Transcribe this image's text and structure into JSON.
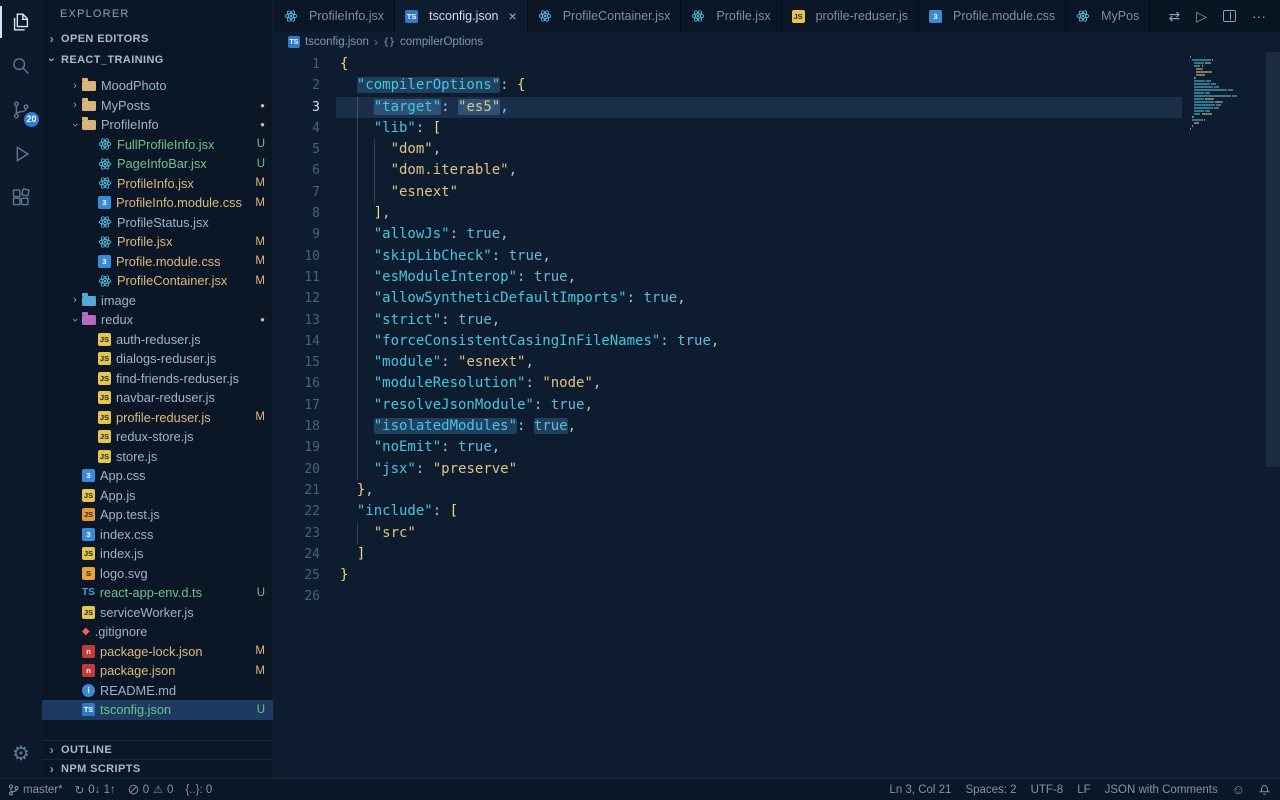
{
  "activity_bar": {
    "badge": "20"
  },
  "sidebar": {
    "title": "EXPLORER",
    "sections": {
      "open_editors": "OPEN EDITORS",
      "project": "REACT_TRAINING",
      "outline": "OUTLINE",
      "npm_scripts": "NPM SCRIPTS"
    },
    "tree": [
      {
        "label": "MoodPhoto",
        "icon": "folder",
        "depth": 1,
        "folder": true,
        "expanded": false
      },
      {
        "label": "MyPosts",
        "icon": "folder",
        "depth": 1,
        "folder": true,
        "expanded": false,
        "dot": true
      },
      {
        "label": "ProfileInfo",
        "icon": "folder",
        "depth": 1,
        "folder": true,
        "expanded": true,
        "dot": true
      },
      {
        "label": "FullProfileInfo.jsx",
        "icon": "react",
        "depth": 2,
        "badge": "U",
        "git": "unt"
      },
      {
        "label": "PageInfoBar.jsx",
        "icon": "react",
        "depth": 2,
        "badge": "U",
        "git": "unt"
      },
      {
        "label": "ProfileInfo.jsx",
        "icon": "react",
        "depth": 2,
        "badge": "M",
        "git": "mod"
      },
      {
        "label": "ProfileInfo.module.css",
        "icon": "css",
        "depth": 2,
        "badge": "M",
        "git": "mod"
      },
      {
        "label": "ProfileStatus.jsx",
        "icon": "react",
        "depth": 2
      },
      {
        "label": "Profile.jsx",
        "icon": "react",
        "depth": 2,
        "badge": "M",
        "git": "mod"
      },
      {
        "label": "Profile.module.css",
        "icon": "css",
        "depth": 2,
        "badge": "M",
        "git": "mod"
      },
      {
        "label": "ProfileContainer.jsx",
        "icon": "react",
        "depth": 2,
        "badge": "M",
        "git": "mod"
      },
      {
        "label": "image",
        "icon": "folder-image",
        "depth": 1,
        "folder": true,
        "expanded": false
      },
      {
        "label": "redux",
        "icon": "folder-redux",
        "depth": 1,
        "folder": true,
        "expanded": true,
        "dot": true
      },
      {
        "label": "auth-reduser.js",
        "icon": "js",
        "depth": 2
      },
      {
        "label": "dialogs-reduser.js",
        "icon": "js",
        "depth": 2
      },
      {
        "label": "find-friends-reduser.js",
        "icon": "js",
        "depth": 2
      },
      {
        "label": "navbar-reduser.js",
        "icon": "js",
        "depth": 2
      },
      {
        "label": "profile-reduser.js",
        "icon": "js",
        "depth": 2,
        "badge": "M",
        "git": "mod"
      },
      {
        "label": "redux-store.js",
        "icon": "js",
        "depth": 2
      },
      {
        "label": "store.js",
        "icon": "js",
        "depth": 2
      },
      {
        "label": "App.css",
        "icon": "css",
        "depth": 1
      },
      {
        "label": "App.js",
        "icon": "js",
        "depth": 1
      },
      {
        "label": "App.test.js",
        "icon": "jstest",
        "depth": 1
      },
      {
        "label": "index.css",
        "icon": "css",
        "depth": 1
      },
      {
        "label": "index.js",
        "icon": "js",
        "depth": 1
      },
      {
        "label": "logo.svg",
        "icon": "svg",
        "depth": 1
      },
      {
        "label": "react-app-env.d.ts",
        "icon": "dts",
        "depth": 1,
        "badge": "U",
        "git": "unt"
      },
      {
        "label": "serviceWorker.js",
        "icon": "js",
        "depth": 1
      },
      {
        "label": ".gitignore",
        "icon": "git",
        "depth": 1
      },
      {
        "label": "package-lock.json",
        "icon": "npm",
        "depth": 1,
        "badge": "M",
        "git": "mod"
      },
      {
        "label": "package.json",
        "icon": "npm",
        "depth": 1,
        "badge": "M",
        "git": "mod"
      },
      {
        "label": "README.md",
        "icon": "readme",
        "depth": 1
      },
      {
        "label": "tsconfig.json",
        "icon": "ts",
        "depth": 1,
        "badge": "U",
        "git": "unt",
        "selected": true
      }
    ]
  },
  "tabs": {
    "items": [
      {
        "label": "ProfileInfo.jsx",
        "icon": "react"
      },
      {
        "label": "tsconfig.json",
        "icon": "ts",
        "active": true,
        "close": true
      },
      {
        "label": "ProfileContainer.jsx",
        "icon": "react"
      },
      {
        "label": "Profile.jsx",
        "icon": "react"
      },
      {
        "label": "profile-reduser.js",
        "icon": "js"
      },
      {
        "label": "Profile.module.css",
        "icon": "css"
      },
      {
        "label": "MyPos",
        "icon": "react"
      }
    ],
    "actions": {
      "compare": "⇄",
      "run": "▷",
      "more": "···"
    }
  },
  "breadcrumb": {
    "file": "tsconfig.json",
    "symbol_glyph": "{}",
    "symbol": "compilerOptions"
  },
  "editor": {
    "active_line": 3,
    "lines": [
      {
        "n": 1,
        "tokens": [
          {
            "t": "{",
            "c": "brace"
          }
        ]
      },
      {
        "n": 2,
        "tokens": [
          {
            "t": "  ",
            "c": "ws"
          },
          {
            "t": "\"compilerOptions\"",
            "c": "key",
            "h": "occ"
          },
          {
            "t": ":",
            "c": "punc"
          },
          {
            "t": " ",
            "c": "ws"
          },
          {
            "t": "{",
            "c": "brace"
          }
        ]
      },
      {
        "n": 3,
        "tokens": [
          {
            "t": "    ",
            "c": "ws"
          },
          {
            "t": "\"target\"",
            "c": "key",
            "h": "sel"
          },
          {
            "t": ":",
            "c": "punc"
          },
          {
            "t": " ",
            "c": "ws"
          },
          {
            "t": "\"es5\"",
            "c": "str",
            "h": "sel"
          },
          {
            "t": ",",
            "c": "punc"
          }
        ]
      },
      {
        "n": 4,
        "tokens": [
          {
            "t": "    ",
            "c": "ws"
          },
          {
            "t": "\"lib\"",
            "c": "key"
          },
          {
            "t": ":",
            "c": "punc"
          },
          {
            "t": " ",
            "c": "ws"
          },
          {
            "t": "[",
            "c": "brace"
          }
        ]
      },
      {
        "n": 5,
        "tokens": [
          {
            "t": "      ",
            "c": "ws"
          },
          {
            "t": "\"dom\"",
            "c": "str"
          },
          {
            "t": ",",
            "c": "punc"
          }
        ]
      },
      {
        "n": 6,
        "tokens": [
          {
            "t": "      ",
            "c": "ws"
          },
          {
            "t": "\"dom.iterable\"",
            "c": "str"
          },
          {
            "t": ",",
            "c": "punc"
          }
        ]
      },
      {
        "n": 7,
        "tokens": [
          {
            "t": "      ",
            "c": "ws"
          },
          {
            "t": "\"esnext\"",
            "c": "str"
          }
        ]
      },
      {
        "n": 8,
        "tokens": [
          {
            "t": "    ",
            "c": "ws"
          },
          {
            "t": "]",
            "c": "brace"
          },
          {
            "t": ",",
            "c": "punc"
          }
        ]
      },
      {
        "n": 9,
        "tokens": [
          {
            "t": "    ",
            "c": "ws"
          },
          {
            "t": "\"allowJs\"",
            "c": "key"
          },
          {
            "t": ":",
            "c": "punc"
          },
          {
            "t": " ",
            "c": "ws"
          },
          {
            "t": "true",
            "c": "bool"
          },
          {
            "t": ",",
            "c": "punc"
          }
        ]
      },
      {
        "n": 10,
        "tokens": [
          {
            "t": "    ",
            "c": "ws"
          },
          {
            "t": "\"skipLibCheck\"",
            "c": "key"
          },
          {
            "t": ":",
            "c": "punc"
          },
          {
            "t": " ",
            "c": "ws"
          },
          {
            "t": "true",
            "c": "bool"
          },
          {
            "t": ",",
            "c": "punc"
          }
        ]
      },
      {
        "n": 11,
        "tokens": [
          {
            "t": "    ",
            "c": "ws"
          },
          {
            "t": "\"esModuleInterop\"",
            "c": "key"
          },
          {
            "t": ":",
            "c": "punc"
          },
          {
            "t": " ",
            "c": "ws"
          },
          {
            "t": "true",
            "c": "bool"
          },
          {
            "t": ",",
            "c": "punc"
          }
        ]
      },
      {
        "n": 12,
        "tokens": [
          {
            "t": "    ",
            "c": "ws"
          },
          {
            "t": "\"allowSyntheticDefaultImports\"",
            "c": "key"
          },
          {
            "t": ":",
            "c": "punc"
          },
          {
            "t": " ",
            "c": "ws"
          },
          {
            "t": "true",
            "c": "bool"
          },
          {
            "t": ",",
            "c": "punc"
          }
        ]
      },
      {
        "n": 13,
        "tokens": [
          {
            "t": "    ",
            "c": "ws"
          },
          {
            "t": "\"strict\"",
            "c": "key"
          },
          {
            "t": ":",
            "c": "punc"
          },
          {
            "t": " ",
            "c": "ws"
          },
          {
            "t": "true",
            "c": "bool"
          },
          {
            "t": ",",
            "c": "punc"
          }
        ]
      },
      {
        "n": 14,
        "tokens": [
          {
            "t": "    ",
            "c": "ws"
          },
          {
            "t": "\"forceConsistentCasingInFileNames\"",
            "c": "key"
          },
          {
            "t": ":",
            "c": "punc"
          },
          {
            "t": " ",
            "c": "ws"
          },
          {
            "t": "true",
            "c": "bool"
          },
          {
            "t": ",",
            "c": "punc"
          }
        ]
      },
      {
        "n": 15,
        "tokens": [
          {
            "t": "    ",
            "c": "ws"
          },
          {
            "t": "\"module\"",
            "c": "key"
          },
          {
            "t": ":",
            "c": "punc"
          },
          {
            "t": " ",
            "c": "ws"
          },
          {
            "t": "\"esnext\"",
            "c": "str"
          },
          {
            "t": ",",
            "c": "punc"
          }
        ]
      },
      {
        "n": 16,
        "tokens": [
          {
            "t": "    ",
            "c": "ws"
          },
          {
            "t": "\"moduleResolution\"",
            "c": "key"
          },
          {
            "t": ":",
            "c": "punc"
          },
          {
            "t": " ",
            "c": "ws"
          },
          {
            "t": "\"node\"",
            "c": "str"
          },
          {
            "t": ",",
            "c": "punc"
          }
        ]
      },
      {
        "n": 17,
        "tokens": [
          {
            "t": "    ",
            "c": "ws"
          },
          {
            "t": "\"resolveJsonModule\"",
            "c": "key"
          },
          {
            "t": ":",
            "c": "punc"
          },
          {
            "t": " ",
            "c": "ws"
          },
          {
            "t": "true",
            "c": "bool"
          },
          {
            "t": ",",
            "c": "punc"
          }
        ]
      },
      {
        "n": 18,
        "tokens": [
          {
            "t": "    ",
            "c": "ws"
          },
          {
            "t": "\"isolatedModules\"",
            "c": "key",
            "h": "occ"
          },
          {
            "t": ":",
            "c": "punc"
          },
          {
            "t": " ",
            "c": "ws"
          },
          {
            "t": "true",
            "c": "bool",
            "h": "occ"
          },
          {
            "t": ",",
            "c": "punc"
          }
        ]
      },
      {
        "n": 19,
        "tokens": [
          {
            "t": "    ",
            "c": "ws"
          },
          {
            "t": "\"noEmit\"",
            "c": "key"
          },
          {
            "t": ":",
            "c": "punc"
          },
          {
            "t": " ",
            "c": "ws"
          },
          {
            "t": "true",
            "c": "bool"
          },
          {
            "t": ",",
            "c": "punc"
          }
        ]
      },
      {
        "n": 20,
        "tokens": [
          {
            "t": "    ",
            "c": "ws"
          },
          {
            "t": "\"jsx\"",
            "c": "key"
          },
          {
            "t": ":",
            "c": "punc"
          },
          {
            "t": " ",
            "c": "ws"
          },
          {
            "t": "\"preserve\"",
            "c": "str"
          }
        ]
      },
      {
        "n": 21,
        "tokens": [
          {
            "t": "  ",
            "c": "ws"
          },
          {
            "t": "}",
            "c": "brace"
          },
          {
            "t": ",",
            "c": "punc"
          }
        ]
      },
      {
        "n": 22,
        "tokens": [
          {
            "t": "  ",
            "c": "ws"
          },
          {
            "t": "\"include\"",
            "c": "key"
          },
          {
            "t": ":",
            "c": "punc"
          },
          {
            "t": " ",
            "c": "ws"
          },
          {
            "t": "[",
            "c": "brace"
          }
        ]
      },
      {
        "n": 23,
        "tokens": [
          {
            "t": "    ",
            "c": "ws"
          },
          {
            "t": "\"src\"",
            "c": "str"
          }
        ]
      },
      {
        "n": 24,
        "tokens": [
          {
            "t": "  ",
            "c": "ws"
          },
          {
            "t": "]",
            "c": "brace"
          }
        ]
      },
      {
        "n": 25,
        "tokens": [
          {
            "t": "}",
            "c": "brace"
          }
        ]
      },
      {
        "n": 26,
        "tokens": []
      }
    ]
  },
  "status_bar": {
    "branch": "master*",
    "sync": "0↓ 1↑",
    "errors": "0",
    "warnings": "0",
    "brackets": "{..}: 0",
    "cursor": "Ln 3, Col 21",
    "indentation": "Spaces: 2",
    "encoding": "UTF-8",
    "eol": "LF",
    "language": "JSON with Comments"
  },
  "icons": {
    "ts": {
      "text": "TS",
      "bg": "#3178c6",
      "fg": "#ffffff",
      "shape": "square"
    },
    "js": {
      "text": "JS",
      "bg": "#e6c54e",
      "fg": "#1c2333",
      "shape": "square"
    },
    "jstest": {
      "text": "JS",
      "bg": "#e39a3b",
      "fg": "#1c2333",
      "shape": "square"
    },
    "css": {
      "text": "3",
      "bg": "#3b8ad8",
      "fg": "#ffffff",
      "shape": "square"
    },
    "npm": {
      "text": "n",
      "bg": "#c43b36",
      "fg": "#ffffff",
      "shape": "square"
    },
    "svg": {
      "text": "S",
      "bg": "#e8a33d",
      "fg": "#1c2333",
      "shape": "square"
    },
    "dts": {
      "text": "TS",
      "bg": "none",
      "fg": "#4d9fd6",
      "shape": "text"
    },
    "git": {
      "text": "◆",
      "bg": "none",
      "fg": "#e8694f",
      "shape": "text"
    },
    "readme": {
      "text": "i",
      "bg": "#3b8ad8",
      "fg": "#ffffff",
      "shape": "round"
    }
  },
  "icon_colors": {
    "folder": "#d8b57a",
    "folder-image": "#56a8d8",
    "folder-redux": "#b36bc4"
  },
  "accent_colors": {
    "react": "#56c4e8",
    "modified": "#dcb97e",
    "untracked": "#6fc28a"
  }
}
